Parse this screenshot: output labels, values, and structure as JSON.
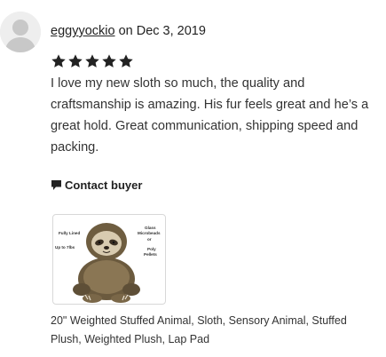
{
  "review": {
    "username": "eggyyockio",
    "date_text": "on Dec 3, 2019",
    "rating": 5,
    "text": "I love my new sloth so much, the quality and craftsmanship is amazing. His fur feels great and he’s a great hold. Great communication, shipping speed and packing.",
    "contact_label": "Contact buyer"
  },
  "product": {
    "title": "20\" Weighted Stuffed Animal, Sloth, Sensory Animal, Stuffed Plush, Weighted Plush, Lap Pad",
    "image_labels": {
      "fully_lined": "Fully Lined",
      "up_to": "Up to 7lbs",
      "glass": "Glass",
      "microbeads": "Microbeads",
      "or": "or",
      "poly": "Poly",
      "pellets": "Pellets"
    }
  },
  "icons": {
    "avatar": "user-avatar-placeholder",
    "star": "star-icon",
    "contact": "message-flag-icon"
  },
  "colors": {
    "star": "#222222",
    "text": "#333333"
  }
}
